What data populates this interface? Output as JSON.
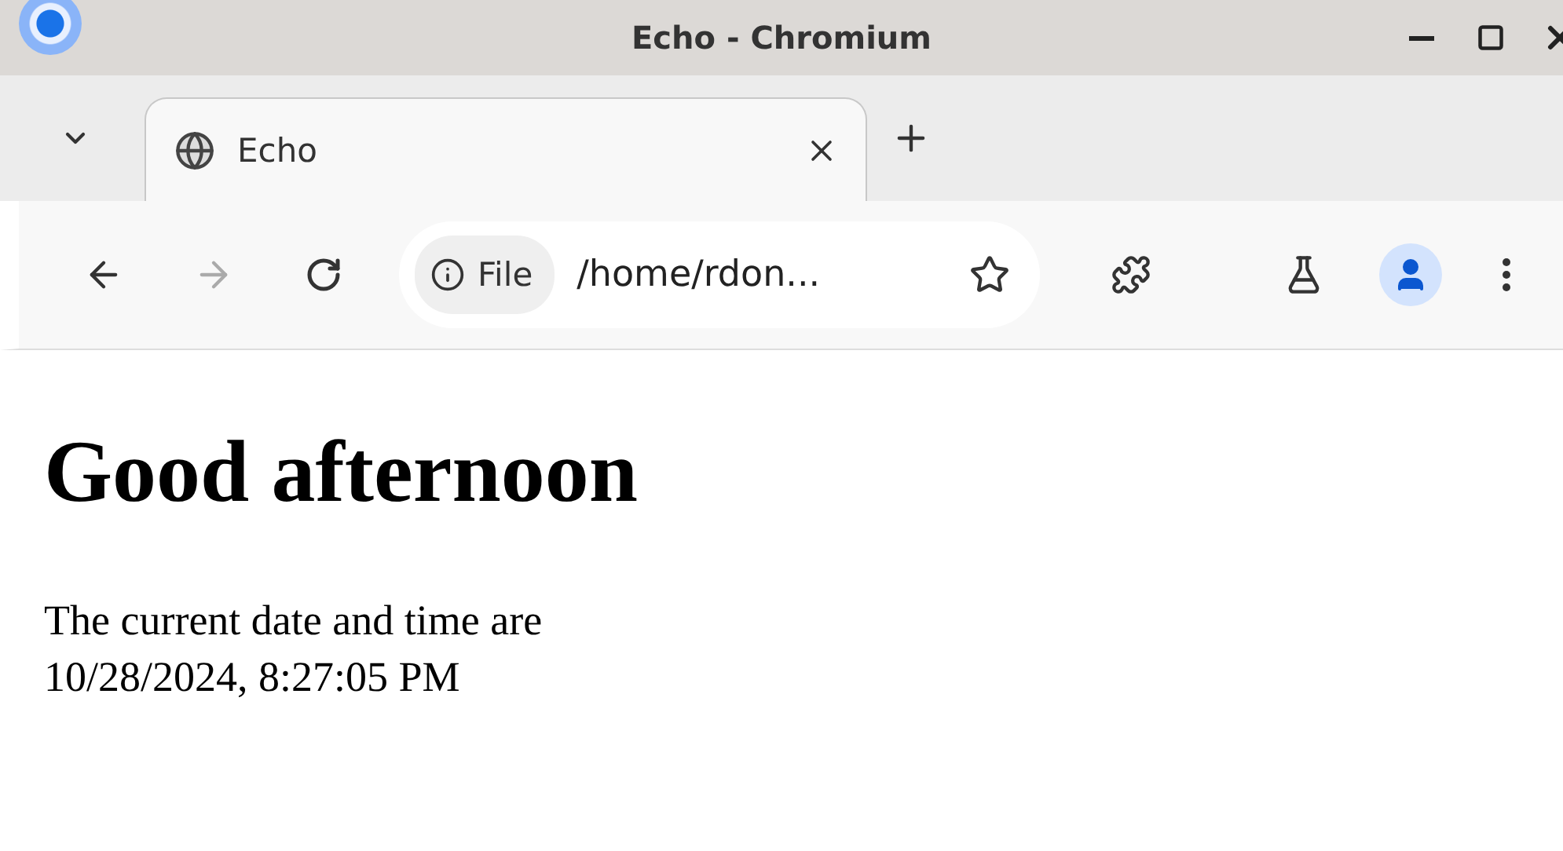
{
  "window": {
    "title": "Echo - Chromium"
  },
  "tabs": [
    {
      "label": "Echo",
      "selected": true
    }
  ],
  "toolbar": {
    "forward_disabled": true,
    "address": {
      "chip": "File",
      "value": "/home/rdon..."
    }
  },
  "page": {
    "heading": "Good afternoon",
    "lines": [
      "The current date and time are",
      "10/28/2024, 8:27:05 PM"
    ]
  }
}
